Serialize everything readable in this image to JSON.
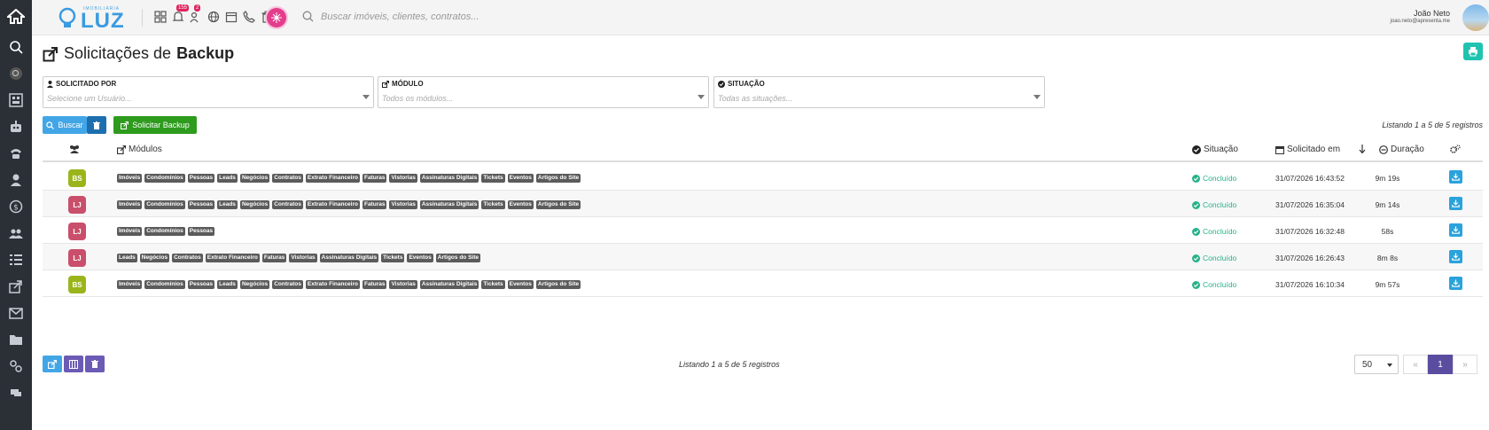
{
  "brand": {
    "name": "LUZ",
    "tagline": "IMOBILIÁRIA"
  },
  "topbar": {
    "notifications_badge": "155",
    "contacts_badge": "2",
    "search_placeholder": "Buscar imóveis, clientes, contratos...",
    "user_name": "João Neto",
    "user_email": "joao.neto@apresenta.me"
  },
  "page": {
    "title_prefix": "Solicitações de",
    "title_bold": "Backup"
  },
  "filters": {
    "requested_by": {
      "label": "SOLICITADO POR",
      "placeholder": "Selecione um Usuário..."
    },
    "module": {
      "label": "MÓDULO",
      "placeholder": "Todos os módulos..."
    },
    "status": {
      "label": "SITUAÇÃO",
      "placeholder": "Todas as situações..."
    }
  },
  "actions": {
    "search": "Buscar",
    "request_backup": "Solicitar Backup"
  },
  "listing": "Listando 1 a 5 de 5 registros",
  "table": {
    "headers": {
      "modules": "Módulos",
      "status": "Situação",
      "requested_at": "Solicitado em",
      "duration": "Duração"
    },
    "rows": [
      {
        "initials": "BS",
        "color": "#9ab51b",
        "modules": [
          "Imóveis",
          "Condomínios",
          "Pessoas",
          "Leads",
          "Negócios",
          "Contratos",
          "Extrato Financeiro",
          "Faturas",
          "Vistorias",
          "Assinaturas Digitais",
          "Tickets",
          "Eventos",
          "Artigos do Site"
        ],
        "status": "Concluído",
        "date": "31/07/2026 16:43:52",
        "duration": "9m 19s"
      },
      {
        "initials": "LJ",
        "color": "#c94f6b",
        "modules": [
          "Imóveis",
          "Condomínios",
          "Pessoas",
          "Leads",
          "Negócios",
          "Contratos",
          "Extrato Financeiro",
          "Faturas",
          "Vistorias",
          "Assinaturas Digitais",
          "Tickets",
          "Eventos",
          "Artigos do Site"
        ],
        "status": "Concluído",
        "date": "31/07/2026 16:35:04",
        "duration": "9m 14s"
      },
      {
        "initials": "LJ",
        "color": "#c94f6b",
        "modules": [
          "Imóveis",
          "Condomínios",
          "Pessoas"
        ],
        "status": "Concluído",
        "date": "31/07/2026 16:32:48",
        "duration": "58s"
      },
      {
        "initials": "LJ",
        "color": "#c94f6b",
        "modules": [
          "Leads",
          "Negócios",
          "Contratos",
          "Extrato Financeiro",
          "Faturas",
          "Vistorias",
          "Assinaturas Digitais",
          "Tickets",
          "Eventos",
          "Artigos do Site"
        ],
        "status": "Concluído",
        "date": "31/07/2026 16:26:43",
        "duration": "8m 8s"
      },
      {
        "initials": "BS",
        "color": "#9ab51b",
        "modules": [
          "Imóveis",
          "Condomínios",
          "Pessoas",
          "Leads",
          "Negócios",
          "Contratos",
          "Extrato Financeiro",
          "Faturas",
          "Vistorias",
          "Assinaturas Digitais",
          "Tickets",
          "Eventos",
          "Artigos do Site"
        ],
        "status": "Concluído",
        "date": "31/07/2026 16:10:34",
        "duration": "9m 57s"
      }
    ]
  },
  "pagination": {
    "page_size": "50",
    "current_page": "1",
    "first": "«",
    "last": "»"
  },
  "colors": {
    "primary": "#3a9be0",
    "success": "#2e9b1e",
    "teal": "#1fc3b0",
    "purple": "#5a4da0",
    "sidebar": "#2b2f36"
  }
}
